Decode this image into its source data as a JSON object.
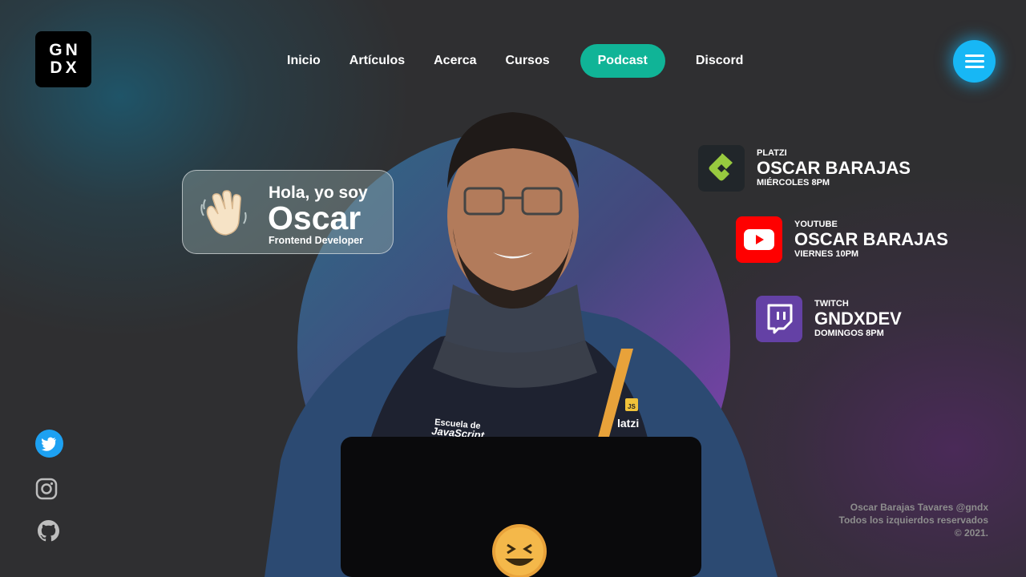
{
  "logo": {
    "line1": "GN",
    "line2": "DX"
  },
  "nav": {
    "items": [
      {
        "label": "Inicio"
      },
      {
        "label": "Artículos"
      },
      {
        "label": "Acerca"
      },
      {
        "label": "Cursos"
      },
      {
        "label": "Podcast",
        "active": true
      },
      {
        "label": "Discord"
      }
    ]
  },
  "menu_button": {
    "icon": "hamburger-icon",
    "color": "#17b7f5"
  },
  "greeting": {
    "emoji": "waving-hand-icon",
    "line1": "Hola, yo soy",
    "name": "Oscar",
    "role": "Frontend Developer"
  },
  "schedule": [
    {
      "platform": "PLATZI",
      "name": "OSCAR BARAJAS",
      "when": "MIÉRCOLES 8PM",
      "icon": "platzi-icon",
      "color": "#21262a"
    },
    {
      "platform": "YOUTUBE",
      "name": "OSCAR BARAJAS",
      "when": "VIERNES 10PM",
      "icon": "youtube-icon",
      "color": "#ff0000"
    },
    {
      "platform": "TWITCH",
      "name": "GNDXDEV",
      "when": "DOMINGOS 8PM",
      "icon": "twitch-icon",
      "color": "#6441a5"
    }
  ],
  "social": [
    {
      "icon": "twitter-icon",
      "color": "#1da1f2"
    },
    {
      "icon": "instagram-icon",
      "color": "#bdbdbd"
    },
    {
      "icon": "github-icon",
      "color": "#bdbdbd"
    }
  ],
  "photo": {
    "shirt_line1": "Escuela de",
    "shirt_line2": "JavaScript",
    "shirt_brand": "latzi",
    "badge": "JS"
  },
  "footer": {
    "line1": "Oscar Barajas Tavares @gndx",
    "line2": "Todos los izquierdos reservados",
    "line3": "© 2021."
  },
  "colors": {
    "accent": "#10b497",
    "background": "#2f2f31"
  }
}
